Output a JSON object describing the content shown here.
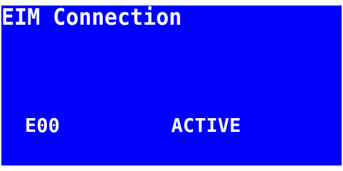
{
  "display": {
    "title": "EIM Connection",
    "channel": "E00",
    "status": "ACTIVE",
    "background_color": "#0000ff",
    "text_color": "#ffffff"
  }
}
